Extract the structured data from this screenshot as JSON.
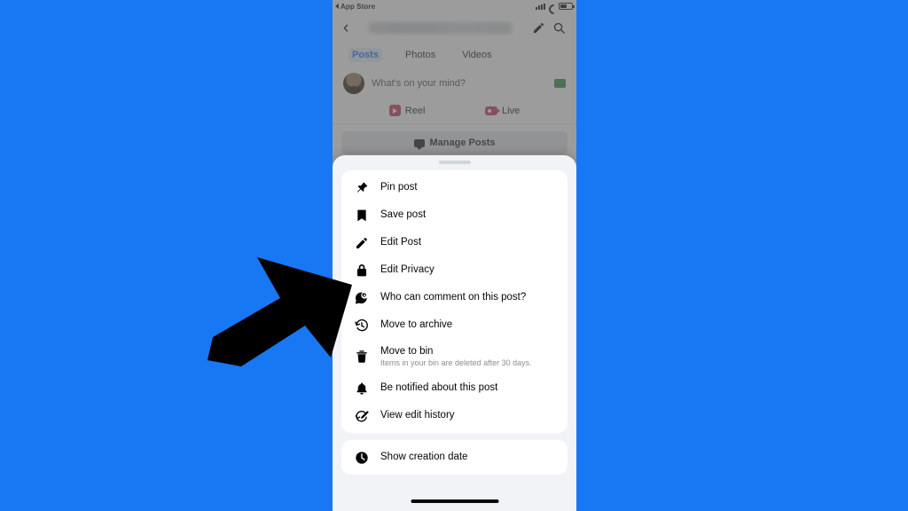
{
  "background": {
    "color": "#1877f2"
  },
  "phone": {
    "status_bar": {
      "left_label": "App Store",
      "back_icon": "back-triangle-icon",
      "signal_icon": "signal-bars-icon",
      "wifi_icon": "wifi-icon",
      "battery_icon": "battery-icon"
    },
    "nav": {
      "back_glyph": "‹",
      "title": "",
      "title_state": "blurred",
      "edit_icon": "pencil-icon",
      "search_icon": "search-icon"
    },
    "tabs": [
      {
        "label": "Posts",
        "active": true
      },
      {
        "label": "Photos",
        "active": false
      },
      {
        "label": "Videos",
        "active": false
      }
    ],
    "composer": {
      "placeholder": "What's on your mind?",
      "avatar_icon": "avatar",
      "attachment_icon": "green-photo-icon"
    },
    "actions": [
      {
        "label": "Reel",
        "icon": "reel-icon"
      },
      {
        "label": "Live",
        "icon": "live-icon"
      }
    ],
    "manage_posts": {
      "label": "Manage Posts",
      "icon": "manage-posts-icon"
    },
    "home_indicator": "home-bar"
  },
  "sheet": {
    "grabber": "drag-handle",
    "groups": [
      {
        "items": [
          {
            "label": "Pin post",
            "sub": "",
            "icon": "pin-icon"
          },
          {
            "label": "Save post",
            "sub": "",
            "icon": "bookmark-icon"
          },
          {
            "label": "Edit Post",
            "sub": "",
            "icon": "pencil-icon"
          },
          {
            "label": "Edit Privacy",
            "sub": "",
            "icon": "lock-icon"
          },
          {
            "label": "Who can comment on this post?",
            "sub": "",
            "icon": "comment-settings-icon"
          },
          {
            "label": "Move to archive",
            "sub": "",
            "icon": "archive-clock-icon"
          },
          {
            "label": "Move to bin",
            "sub": "Items in your bin are deleted after 30 days.",
            "icon": "trash-icon"
          },
          {
            "label": "Be notified about this post",
            "sub": "",
            "icon": "bell-icon"
          },
          {
            "label": "View edit history",
            "sub": "",
            "icon": "edit-history-icon"
          }
        ]
      },
      {
        "items": [
          {
            "label": "Show creation date",
            "sub": "",
            "icon": "clock-filled-icon"
          }
        ]
      }
    ]
  },
  "cursor": {
    "icon": "arrow-pointer",
    "points_at": "Edit Privacy"
  }
}
